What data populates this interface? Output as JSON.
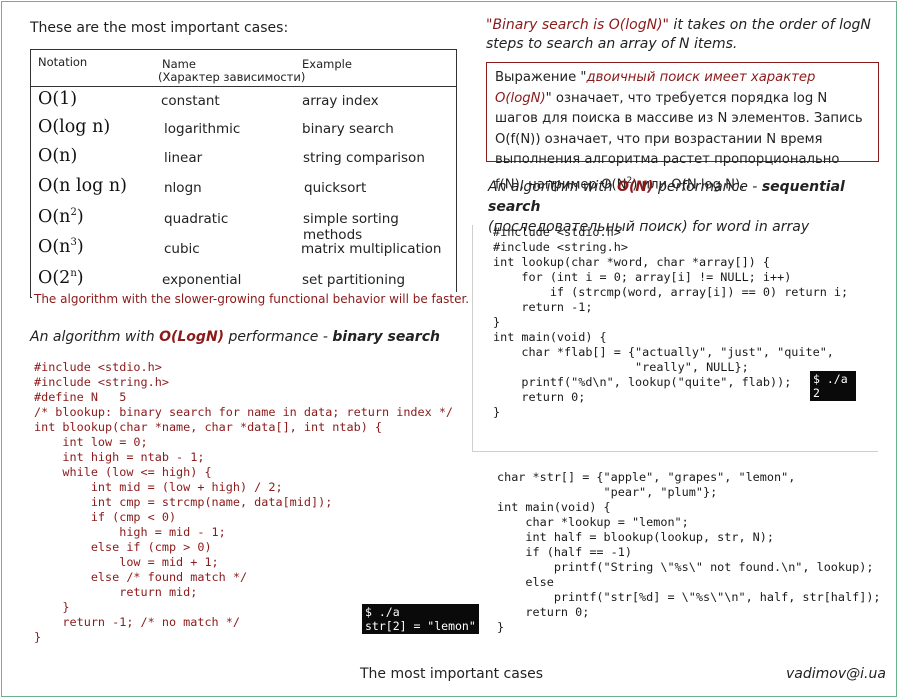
{
  "colors": {
    "accent_border": "#69b38a",
    "dark_red": "#8b1a1a",
    "terminal_bg": "#0a0a0a"
  },
  "table_section": {
    "heading": "These are the most important cases:",
    "headers": {
      "notation": "Notation",
      "name": "Name",
      "name_sub": "(Характер зависимости)",
      "example": "Example"
    },
    "rows": [
      {
        "base": "O(1)",
        "sup": "",
        "name": "constant",
        "example": "array index"
      },
      {
        "base": "O(log n)",
        "sup": "",
        "name": "logarithmic",
        "example": "binary search"
      },
      {
        "base": "O(n)",
        "sup": "",
        "name": "linear",
        "example": "string comparison"
      },
      {
        "base": "O(n log n)",
        "sup": "",
        "name": "nlogn",
        "example": "quicksort"
      },
      {
        "base": "O(n",
        "sup": "2",
        "tail": ")",
        "name": "quadratic",
        "example": "simple sorting methods"
      },
      {
        "base": "O(n",
        "sup": "3",
        "tail": ")",
        "name": "cubic",
        "example": "matrix multiplication"
      },
      {
        "base": "O(2",
        "sup": "n",
        "tail": ")",
        "name": "exponential",
        "example": "set partitioning"
      }
    ],
    "note": "The algorithm with the slower-growing functional behavior will be faster."
  },
  "right_intro": {
    "quote": "\"Binary search is O(logN)\"",
    "rest": " it takes on the order of logN steps to search an array of N items."
  },
  "ru_box": {
    "prefix": "Выражение \"",
    "quote": "двоичный поиск имеет характер O(logN)",
    "suffix": "\" означает, что требуется порядка log N шагов для поиска в массиве из N элементов. Запись O(f(N)) означает, что при возрастании N время выполнения алгоритма растет пропорционально f(N), например O(N",
    "sup": "2",
    "end": ") или O(N log N)."
  },
  "binary_section": {
    "title_a": "An algorithm with ",
    "title_b": "O(LogN)",
    "title_c": " performance - ",
    "title_d": "binary search",
    "code": [
      "#include <stdio.h>",
      "#include <string.h>",
      "#define N   5",
      "/* blookup: binary search for name in data; return index */",
      "int blookup(char *name, char *data[], int ntab) {",
      "    int low = 0;",
      "    int high = ntab - 1;",
      "    while (low <= high) {",
      "        int mid = (low + high) / 2;",
      "        int cmp = strcmp(name, data[mid]);",
      "        if (cmp < 0)",
      "            high = mid - 1;",
      "        else if (cmp > 0)",
      "            low = mid + 1;",
      "        else /* found match */",
      "            return mid;",
      "    }",
      "    return -1; /* no match */",
      "}"
    ],
    "terminal": [
      "$ ./a",
      "str[2] = \"lemon\""
    ]
  },
  "sequential_section": {
    "title_a": "An algorithm with ",
    "title_b": "O(N)",
    "title_c": " performance - ",
    "title_d": "sequential search",
    "title_e": "(последовательный поиск) for word in array",
    "code": [
      "#include <stdio.h>",
      "#include <string.h>",
      "int lookup(char *word, char *array[]) {",
      "    for (int i = 0; array[i] != NULL; i++)",
      "        if (strcmp(word, array[i]) == 0) return i;",
      "    return -1;",
      "}",
      "int main(void) {",
      "    char *flab[] = {\"actually\", \"just\", \"quite\",",
      "                    \"really\", NULL};",
      "    printf(\"%d\\n\", lookup(\"quite\", flab));",
      "    return 0;",
      "}"
    ],
    "terminal": [
      "$ ./a",
      "2"
    ]
  },
  "main_section": {
    "code": [
      "char *str[] = {\"apple\", \"grapes\", \"lemon\",",
      "               \"pear\", \"plum\"};",
      "int main(void) {",
      "    char *lookup = \"lemon\";",
      "    int half = blookup(lookup, str, N);",
      "    if (half == -1)",
      "        printf(\"String \\\"%s\\\" not found.\\n\", lookup);",
      "    else",
      "        printf(\"str[%d] = \\\"%s\\\"\\n\", half, str[half]);",
      "    return 0;",
      "}"
    ]
  },
  "footer": {
    "center": "The most important cases",
    "right": "vadimov@i.ua"
  }
}
